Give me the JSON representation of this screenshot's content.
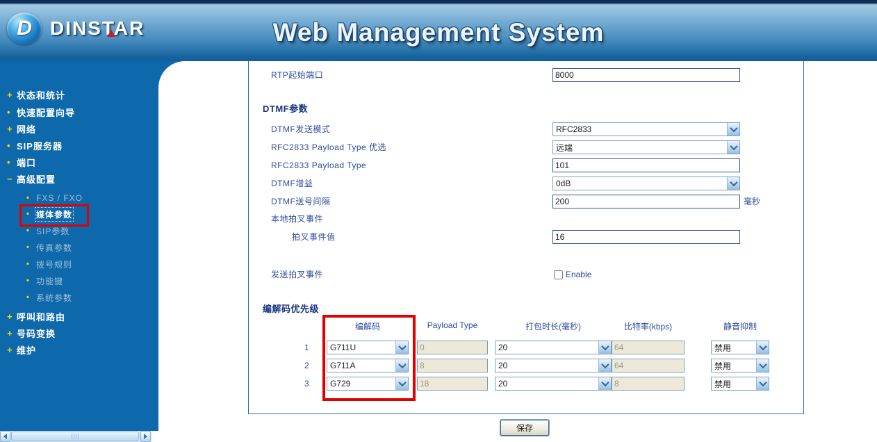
{
  "header": {
    "logo_text": "DINSTAR",
    "logo_letter": "D",
    "title": "Web Management System"
  },
  "sidebar": {
    "items": [
      {
        "bullet": "+",
        "label": "状态和统计"
      },
      {
        "bullet": "•",
        "label": "快速配置向导"
      },
      {
        "bullet": "+",
        "label": "网络"
      },
      {
        "bullet": "•",
        "label": "SIP服务器"
      },
      {
        "bullet": "•",
        "label": "端口"
      },
      {
        "bullet": "−",
        "label": "高级配置"
      },
      {
        "bullet": "•",
        "label": "FXS / FXO"
      },
      {
        "bullet": "•",
        "label": "媒体参数"
      },
      {
        "bullet": "•",
        "label": "SIP参数"
      },
      {
        "bullet": "•",
        "label": "传真参数"
      },
      {
        "bullet": "•",
        "label": "拨号规则"
      },
      {
        "bullet": "•",
        "label": "功能键"
      },
      {
        "bullet": "•",
        "label": "系统参数"
      },
      {
        "bullet": "+",
        "label": "呼叫和路由"
      },
      {
        "bullet": "+",
        "label": "号码变换"
      },
      {
        "bullet": "+",
        "label": "维护"
      }
    ]
  },
  "form": {
    "rtp_port": {
      "label": "RTP起始端口",
      "value": "8000"
    },
    "dtmf_section": "DTMF参数",
    "dtmf_mode": {
      "label": "DTMF发送模式",
      "value": "RFC2833"
    },
    "rfc2833_pref": {
      "label": "RFC2833 Payload Type 优选",
      "value": "远端"
    },
    "rfc2833_pt": {
      "label": "RFC2833 Payload Type",
      "value": "101"
    },
    "dtmf_gain": {
      "label": "DTMF增益",
      "value": "0dB"
    },
    "dtmf_interval": {
      "label": "DTMF送号间隔",
      "value": "200",
      "suffix": "毫秒"
    },
    "local_hookflash": {
      "label": "本地拍叉事件"
    },
    "hookflash_value": {
      "label": "拍叉事件值",
      "value": "16"
    },
    "send_hookflash": {
      "label": "发送拍叉事件",
      "checkbox_label": "Enable"
    },
    "codec_section": "编解码优先级"
  },
  "codec_table": {
    "headers": [
      "编解码",
      "Payload Type",
      "打包时长(毫秒)",
      "比特率(kbps)",
      "静音抑制"
    ],
    "rows": [
      {
        "index": "1",
        "codec": "G711U",
        "payload_type": "0",
        "ptime": "20",
        "bitrate": "64",
        "vad": "禁用"
      },
      {
        "index": "2",
        "codec": "G711A",
        "payload_type": "8",
        "ptime": "20",
        "bitrate": "64",
        "vad": "禁用"
      },
      {
        "index": "3",
        "codec": "G729",
        "payload_type": "18",
        "ptime": "20",
        "bitrate": "8",
        "vad": "禁用"
      }
    ]
  },
  "save_button": "保存",
  "colors": {
    "annotation_red": "#e10000",
    "sidebar_bg": "#0d69ab",
    "label_blue": "#2d4a9d",
    "disabled_bg": "#ece9d8"
  }
}
